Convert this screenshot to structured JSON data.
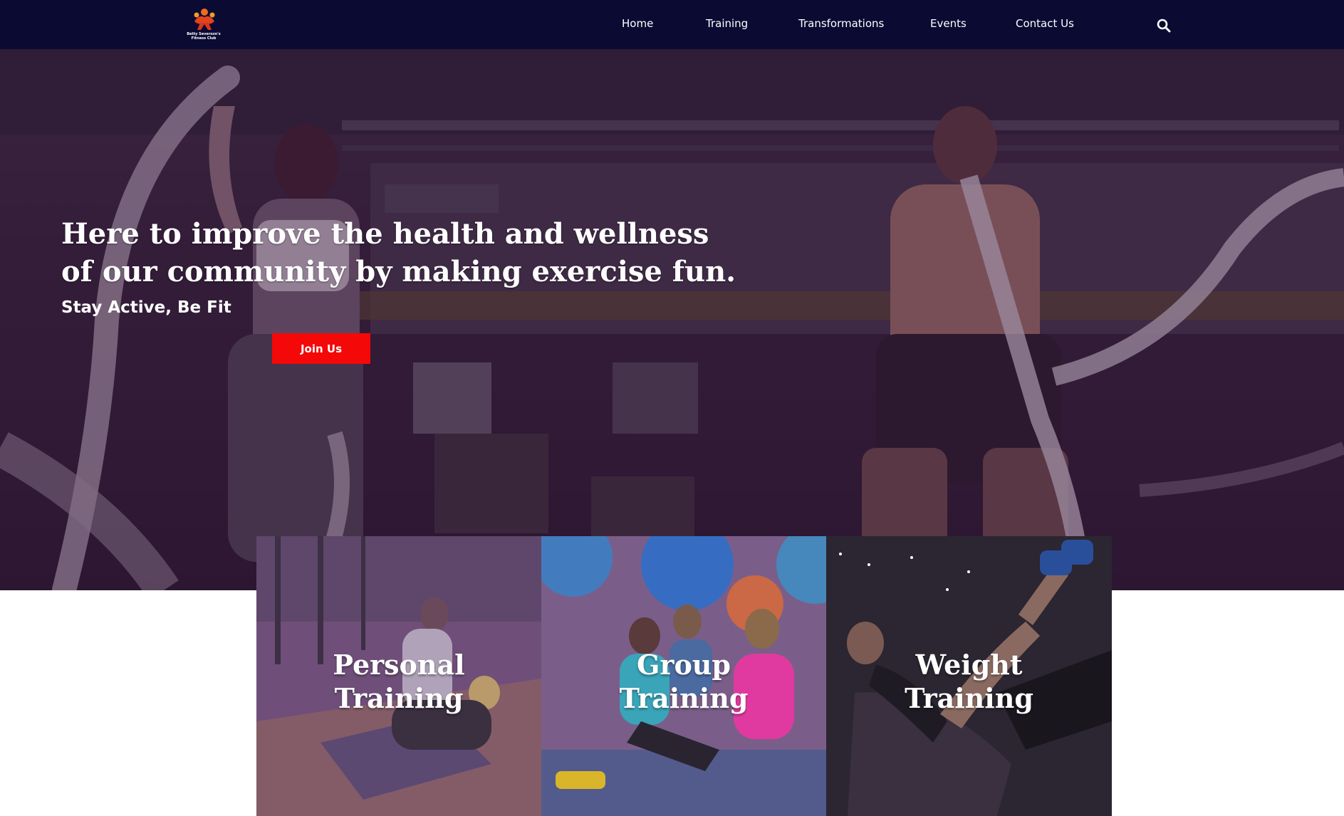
{
  "brand": {
    "logo_text": "Betty Severson's Fitness Club"
  },
  "nav": {
    "items": [
      {
        "label": "Home"
      },
      {
        "label": "Training"
      },
      {
        "label": "Transformations"
      },
      {
        "label": "Events"
      },
      {
        "label": "Contact Us"
      }
    ],
    "search_icon": "search-icon"
  },
  "hero": {
    "headline_line1": "Here to improve the health and wellness",
    "headline_line2": "of our community by making exercise fun.",
    "tagline": "Stay Active, Be Fit",
    "cta_label": "Join Us"
  },
  "cards": [
    {
      "line1": "Personal",
      "line2": "Training"
    },
    {
      "line1": "Group",
      "line2": "Training"
    },
    {
      "line1": "Weight",
      "line2": "Training"
    }
  ],
  "colors": {
    "nav_bg": "#0b0a33",
    "cta_bg": "#f40808",
    "overlay": "#3c1446"
  }
}
